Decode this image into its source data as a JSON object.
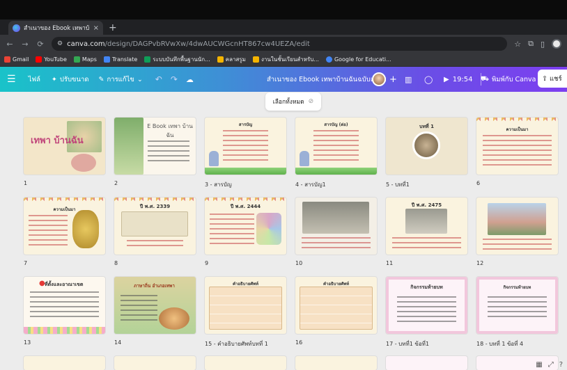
{
  "browser": {
    "tab_title": "สำเนาของ Ebook เทพาบ้านฉัน...",
    "tab_close": "×",
    "new_tab": "+",
    "url_host": "canva.com",
    "url_path": "/design/DAGPvbRVwXw/4dwAUCWGcnHT867cw4UEZA/edit",
    "bookmarks": [
      {
        "label": "Gmail",
        "color": "#ea4335"
      },
      {
        "label": "YouTube",
        "color": "#ff0000"
      },
      {
        "label": "Maps",
        "color": "#34a853"
      },
      {
        "label": "Translate",
        "color": "#4285f4"
      },
      {
        "label": "ระบบบันทึกพื้นฐานนัก...",
        "color": "#0f9d58"
      },
      {
        "label": "คลาสรูม",
        "color": "#f4b400"
      },
      {
        "label": "งานในชั้นเรียนสำหรับ...",
        "color": "#f4b400"
      },
      {
        "label": "Google for Educati...",
        "color": "#4285f4"
      }
    ]
  },
  "canva": {
    "file_label": "ไฟล์",
    "resize_label": "ปรับขนาด",
    "edit_label": "การแก้ไข",
    "doc_name": "สำเนาของ Ebook เทพาบ้านฉันฉบับแก้ไข",
    "present_time": "19:54",
    "print_label": "พิมพ์กับ Canva",
    "share_label": "แชร์"
  },
  "grid": {
    "select_all": "เลือกทั้งหมด",
    "pages": [
      {
        "label": "1",
        "title": "เทพา บ้านฉัน"
      },
      {
        "label": "2",
        "title": "E Book เทพา บ้านฉัน"
      },
      {
        "label": "3 - สารบัญ",
        "title": "สารบัญ"
      },
      {
        "label": "4 - สารบัญ1",
        "title": "สารบัญ (ต่อ)"
      },
      {
        "label": "5 - บทที่1",
        "title": "บทที่ 1"
      },
      {
        "label": "6",
        "title": "ความเป็นมา"
      },
      {
        "label": "7",
        "title": "ความเป็นมา"
      },
      {
        "label": "8",
        "title": "ปี พ.ศ. 2339"
      },
      {
        "label": "9",
        "title": "ปี พ.ศ. 2444"
      },
      {
        "label": "10",
        "title": ""
      },
      {
        "label": "11",
        "title": "ปี พ.ศ. 2475"
      },
      {
        "label": "12",
        "title": ""
      },
      {
        "label": "13",
        "title": "ที่ตั้งและอาณาเขต"
      },
      {
        "label": "14",
        "title": "ภาษาถิ่น อำเภอเทพา"
      },
      {
        "label": "15 - คำอธิบายศัพท์บทที่ 1",
        "title": "คำอธิบายศัพท์"
      },
      {
        "label": "16",
        "title": "คำอธิบายศัพท์"
      },
      {
        "label": "17 - บทที่1 ข้อที่1",
        "title": "กิจกรรมท้ายบท"
      },
      {
        "label": "18 - บทที่ 1 ข้อที่ 4",
        "title": "กิจกรรมท้ายบท"
      }
    ]
  },
  "colors": {
    "toolbar_start": "#19c3c9",
    "toolbar_end": "#7d3ff0",
    "grid_bg": "#ececec"
  }
}
